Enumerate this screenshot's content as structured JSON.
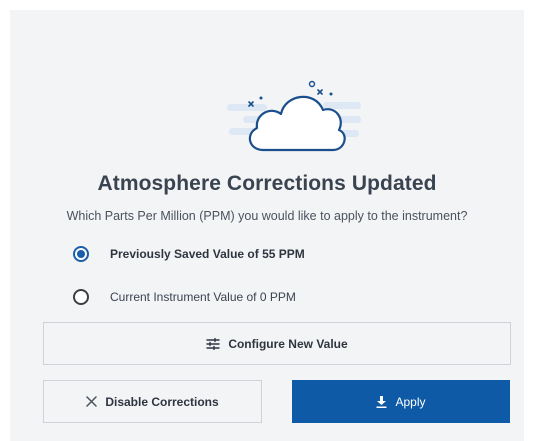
{
  "dialog": {
    "title": "Atmosphere Corrections Updated",
    "subtitle": "Which Parts Per Million (PPM) you would like to apply to the instrument?"
  },
  "options": [
    {
      "label": "Previously Saved Value of 55 PPM",
      "selected": true
    },
    {
      "label": "Current Instrument Value of 0 PPM",
      "selected": false
    }
  ],
  "buttons": {
    "configure_label": "Configure New Value",
    "disable_label": "Disable Corrections",
    "apply_label": "Apply"
  },
  "icons": {
    "illustration": "cloud-icon",
    "configure": "sliders-icon",
    "disable": "close-icon",
    "apply": "download-icon"
  },
  "colors": {
    "accent": "#0f5aa6",
    "panel_background": "#f3f4f6",
    "illustration_light": "#dde8f4"
  }
}
